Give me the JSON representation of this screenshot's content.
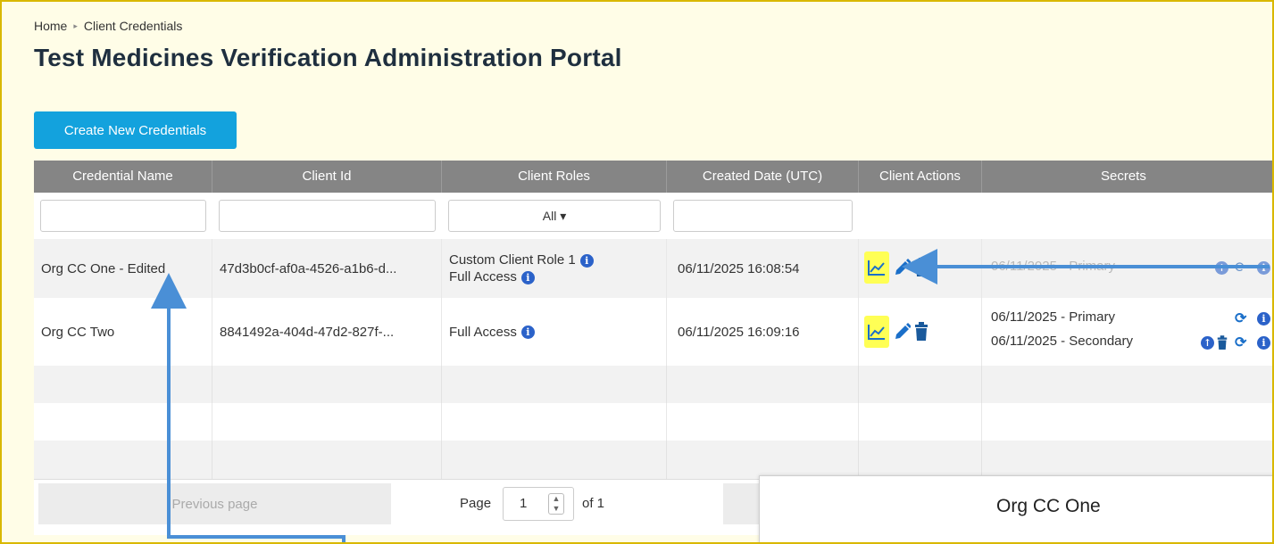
{
  "breadcrumb": {
    "home": "Home",
    "sep": "▸",
    "current": "Client Credentials"
  },
  "page_title": "Test Medicines Verification Administration Portal",
  "create_button": "Create New Credentials",
  "columns": [
    "Credential Name",
    "Client Id",
    "Client Roles",
    "Created Date (UTC)",
    "Client Actions",
    "Secrets"
  ],
  "filters": {
    "roles_select": "All ▾"
  },
  "rows": [
    {
      "name": "Org CC One - Edited",
      "client_id": "47d3b0cf-af0a-4526-a1b6-d...",
      "roles": [
        "Custom Client Role 1",
        "Full Access"
      ],
      "created": "06/11/2025 16:08:54",
      "secrets": [
        "06/11/2025 - Primary"
      ]
    },
    {
      "name": "Org CC Two",
      "client_id": "8841492a-404d-47d2-827f-...",
      "roles": [
        "Full Access"
      ],
      "created": "06/11/2025 16:09:16",
      "secrets": [
        "06/11/2025 - Primary",
        "06/11/2025 - Secondary"
      ]
    }
  ],
  "pager": {
    "prev": "Previous page",
    "page_label": "Page",
    "page_value": "1",
    "of_label": "of 1"
  },
  "popup": {
    "title": "Org CC One"
  },
  "icons": {
    "info": "info-circle-icon",
    "chart": "line-chart-icon",
    "edit": "pencil-icon",
    "delete": "trash-icon",
    "refresh": "refresh-icon",
    "upload": "upload-circle-icon"
  },
  "colors": {
    "accent": "#13a2dd",
    "header": "#858585",
    "highlight": "#ffff55",
    "icon": "#1a6fc9",
    "arrow": "#4a8fd6"
  }
}
